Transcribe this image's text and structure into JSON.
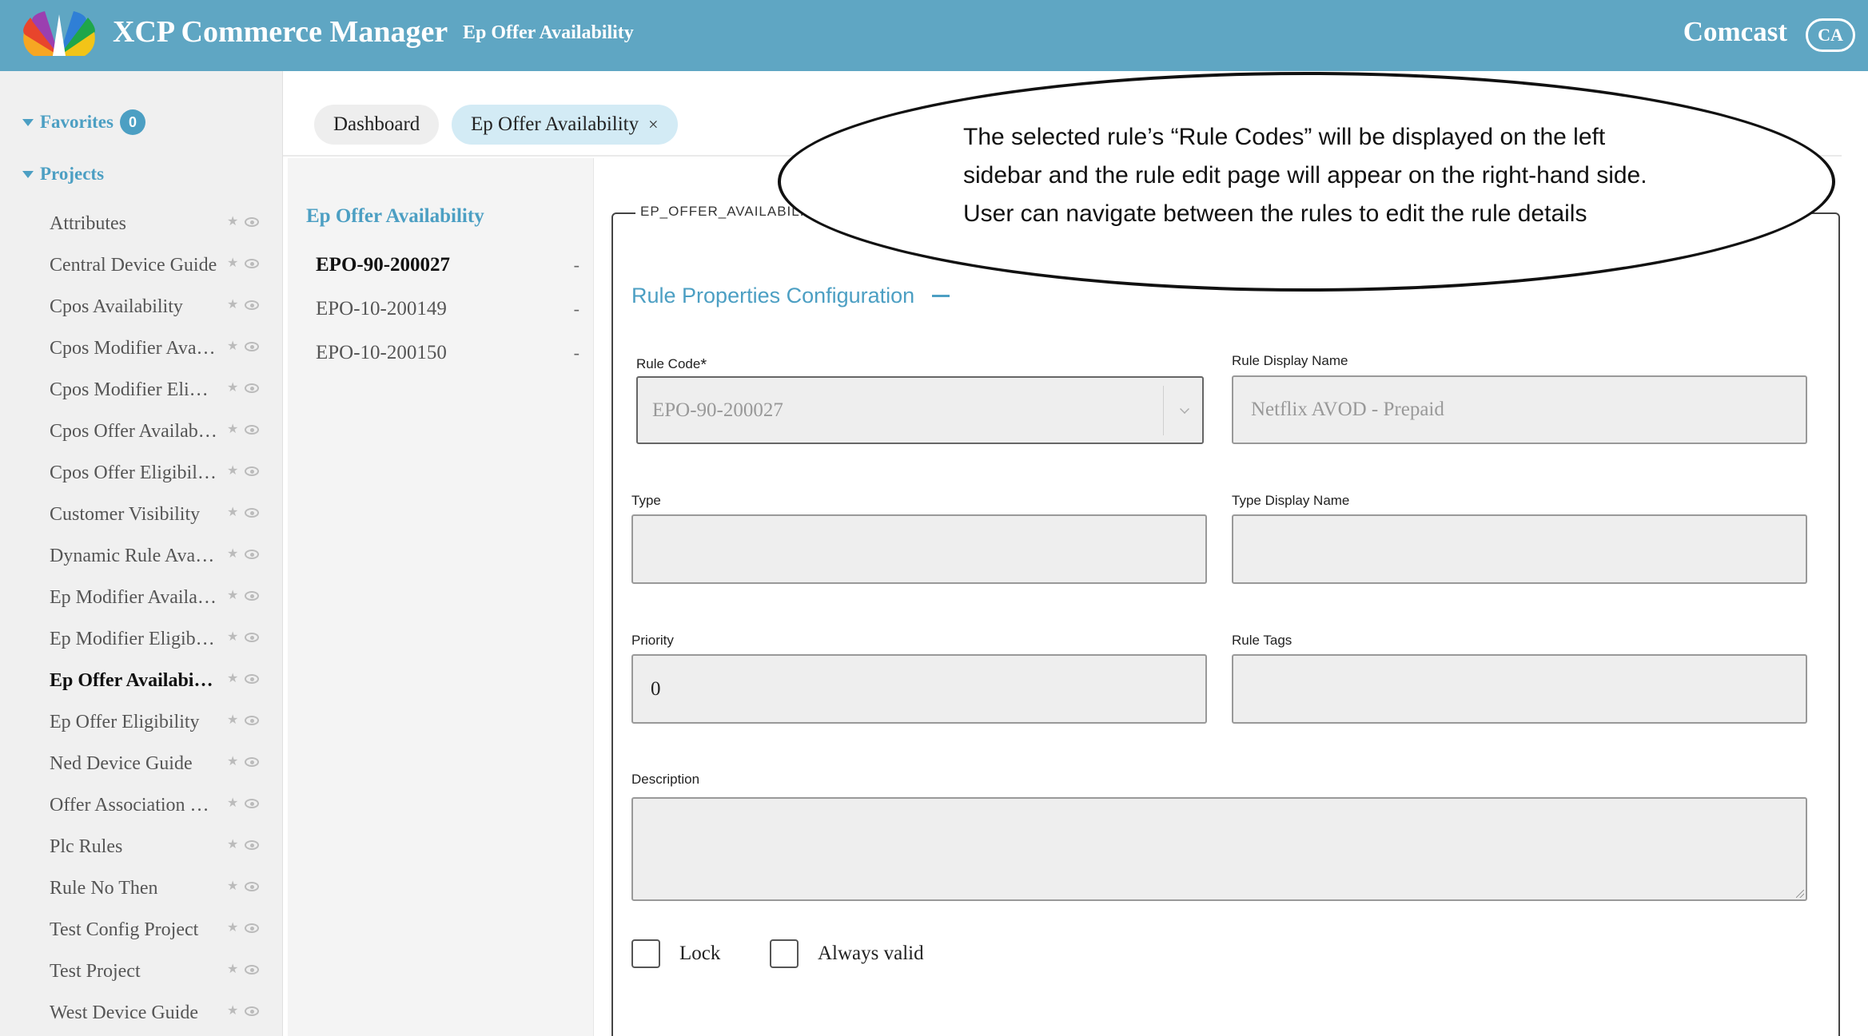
{
  "header": {
    "app_title": "XCP Commerce Manager",
    "module_title": "Ep Offer Availability",
    "brand": "Comcast",
    "region_badge": "CA",
    "bg_color": "#5fa6c3"
  },
  "sidebar": {
    "favorites_label": "Favorites",
    "favorites_count": "0",
    "projects_label": "Projects",
    "projects": [
      {
        "label": "Attributes"
      },
      {
        "label": "Central Device Guide"
      },
      {
        "label": "Cpos Availability"
      },
      {
        "label": "Cpos Modifier Availability"
      },
      {
        "label": "Cpos Modifier Eligibility"
      },
      {
        "label": "Cpos Offer Availability"
      },
      {
        "label": "Cpos Offer Eligibility"
      },
      {
        "label": "Customer Visibility"
      },
      {
        "label": "Dynamic Rule Availability"
      },
      {
        "label": "Ep Modifier Availability"
      },
      {
        "label": "Ep Modifier Eligibility"
      },
      {
        "label": "Ep Offer Availability",
        "active": true
      },
      {
        "label": "Ep Offer Eligibility"
      },
      {
        "label": "Ned Device Guide"
      },
      {
        "label": "Offer Association Rules"
      },
      {
        "label": "Plc Rules"
      },
      {
        "label": "Rule No Then"
      },
      {
        "label": "Test Config Project"
      },
      {
        "label": "Test Project"
      },
      {
        "label": "West Device Guide"
      }
    ]
  },
  "tabs": {
    "dashboard": "Dashboard",
    "active": "Ep Offer Availability",
    "close": "×"
  },
  "rules_panel": {
    "title": "Ep Offer Availability",
    "items": [
      {
        "code": "EPO-90-200027",
        "marker": "-",
        "active": true
      },
      {
        "code": "EPO-10-200149",
        "marker": "-"
      },
      {
        "code": "EPO-10-200150",
        "marker": "-"
      }
    ]
  },
  "form": {
    "legend": "EP_OFFER_AVAILABILITY",
    "section_title": "Rule Properties Configuration",
    "rule_code_label": "Rule Code",
    "rule_code_required": "*",
    "rule_code_value": "EPO-90-200027",
    "rule_display_name_label": "Rule Display Name",
    "rule_display_name_value": "Netflix AVOD - Prepaid",
    "type_label": "Type",
    "type_value": "",
    "type_display_name_label": "Type Display Name",
    "type_display_name_value": "",
    "priority_label": "Priority",
    "priority_value": "0",
    "rule_tags_label": "Rule Tags",
    "rule_tags_value": "",
    "description_label": "Description",
    "description_value": "",
    "lock_label": "Lock",
    "lock_checked": false,
    "always_valid_label": "Always valid",
    "always_valid_checked": false
  },
  "annotation": {
    "lines": [
      "The selected rule’s “Rule Codes” will be displayed on the left",
      "sidebar and the rule edit page will appear on the right-hand side.",
      "User can navigate between the rules to edit the rule details"
    ]
  }
}
